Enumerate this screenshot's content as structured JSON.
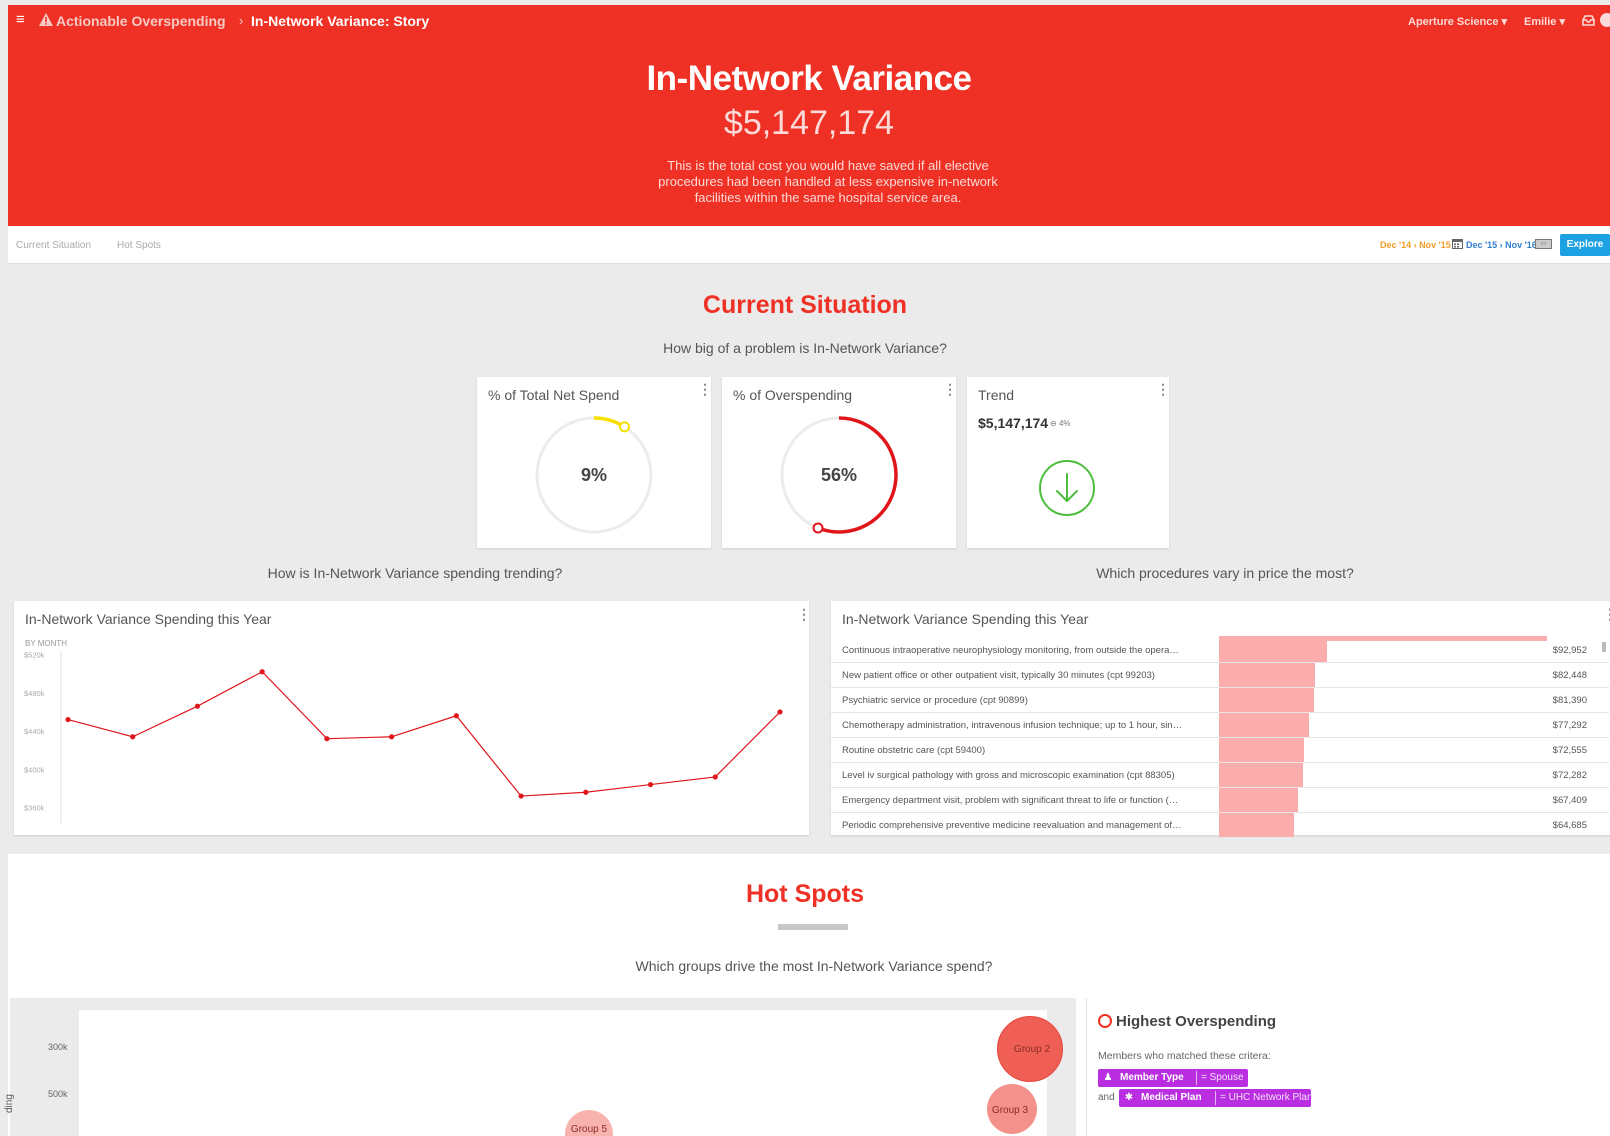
{
  "header": {
    "breadcrumb": [
      "Actionable Overspending",
      "In-Network Variance: Story"
    ],
    "breadcrumb_separator": "›",
    "org": "Aperture Science ▾",
    "user": "Emilie ▾",
    "title": "In-Network Variance",
    "value": "$5,147,174",
    "description": "This is the total cost you would have saved if all elective procedures had been handled at less expensive in-network facilities within the same hospital service area.",
    "accent_color": "#ee3124",
    "icons": [
      "menu-icon",
      "warning-icon",
      "inbox-icon",
      "help-icon"
    ]
  },
  "nav": {
    "tabs": [
      "Current Situation",
      "Hot Spots"
    ],
    "date_range_a": "Dec '14 › Nov '15",
    "date_range_b": "Dec '15 › Nov '16",
    "explore_label": "Explore"
  },
  "current_situation": {
    "title": "Current Situation",
    "question": "How big of a problem is In-Network Variance?",
    "kpis": [
      {
        "title": "% of Total Net Spend",
        "value": "9%",
        "fraction": 0.09,
        "color": "#f5e000"
      },
      {
        "title": "% of Overspending",
        "value": "56%",
        "fraction": 0.56,
        "color": "#e0161b"
      },
      {
        "title": "Trend",
        "value": "$5,147,174",
        "change": "4%",
        "direction": "down",
        "color": "#4cbe3c"
      }
    ],
    "trend_question": "How is In-Network Variance spending trending?",
    "procedures_question": "Which procedures vary in price the most?"
  },
  "line_chart": {
    "title": "In-Network Variance Spending this Year",
    "subtitle": "BY MONTH",
    "color": "#e0161b"
  },
  "chart_data": {
    "type": "line",
    "x": [
      1,
      2,
      3,
      4,
      5,
      6,
      7,
      8,
      9,
      10,
      11,
      12
    ],
    "values": [
      452,
      434,
      466,
      502,
      432,
      434,
      456,
      372,
      376,
      384,
      392,
      460
    ],
    "ylim": [
      348,
      530
    ],
    "yticks": [
      360,
      400,
      440,
      480,
      520
    ],
    "ytick_labels": [
      "$360k",
      "$400k",
      "$440k",
      "$480k",
      "$520k"
    ],
    "title": "In-Network Variance Spending this Year",
    "xlabel": "",
    "ylabel": ""
  },
  "procedures": {
    "title": "In-Network Variance Spending this Year",
    "bar_color": "#fbadad",
    "max_value": 120000,
    "rows": [
      {
        "name": "Continuous intraoperative neurophysiology monitoring, from outside the opera…",
        "label": "$92,952",
        "value": 92952
      },
      {
        "name": "New patient office or other outpatient visit, typically 30 minutes (cpt 99203)",
        "label": "$82,448",
        "value": 82448
      },
      {
        "name": "Psychiatric service or procedure (cpt 90899)",
        "label": "$81,390",
        "value": 81390
      },
      {
        "name": "Chemotherapy administration, intravenous infusion technique; up to 1 hour, sin…",
        "label": "$77,292",
        "value": 77292
      },
      {
        "name": "Routine obstetric care (cpt 59400)",
        "label": "$72,555",
        "value": 72555
      },
      {
        "name": "Level iv surgical pathology with gross and microscopic examination (cpt 88305)",
        "label": "$72,282",
        "value": 72282
      },
      {
        "name": "Emergency department visit, problem with significant threat to life or function (…",
        "label": "$67,409",
        "value": 67409
      },
      {
        "name": "Periodic comprehensive preventive medicine reevaluation and management of…",
        "label": "$64,685",
        "value": 64685
      }
    ]
  },
  "hot_spots": {
    "title": "Hot Spots",
    "question": "Which groups drive the most In-Network Variance spend?",
    "bubble_ticks": [
      "300k",
      "500k"
    ],
    "y_axis_title": "ding",
    "bubbles": [
      {
        "label": "Group 2",
        "color": "#ef5f55"
      },
      {
        "label": "Group 3",
        "color": "#f3918a"
      },
      {
        "label": "Group 5",
        "color": "#f8b3ae"
      }
    ],
    "panel": {
      "title": "Highest Overspending",
      "description": "Members who matched these critera:",
      "and": "and",
      "filters": [
        {
          "key": "Member Type",
          "value": "= Spouse",
          "icon": "person-icon"
        },
        {
          "key": "Medical Plan",
          "value": "= UHC Network Plan",
          "icon": "medical-icon"
        }
      ]
    }
  }
}
